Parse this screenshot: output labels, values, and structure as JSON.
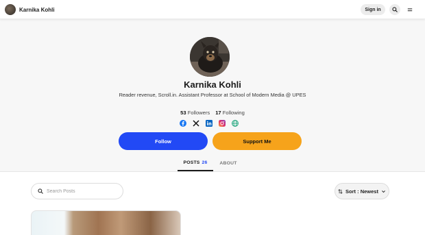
{
  "header": {
    "site_name": "Karnika Kohli",
    "signin_label": "Sign in",
    "search_icon": "search-icon",
    "menu_icon": "menu-icon"
  },
  "profile": {
    "name": "Karnika Kohli",
    "bio": "Reader revenue, Scroll.in. Assistant Professor at School of Modern Media @ UPES",
    "followers_count": "53",
    "followers_label": "Followers",
    "following_count": "17",
    "following_label": "Following",
    "social_links": [
      "facebook-icon",
      "x-icon",
      "linkedin-icon",
      "instagram-icon",
      "globe-icon"
    ]
  },
  "actions": {
    "follow_label": "Follow",
    "support_label": "Support Me"
  },
  "tabs": [
    {
      "label": "POSTS",
      "count": "26",
      "active": true
    },
    {
      "label": "ABOUT",
      "active": false
    }
  ],
  "posts": {
    "search_placeholder": "Search Posts",
    "sort_label": "Sort : Newest"
  },
  "colors": {
    "follow": "#2249f5",
    "support": "#f6a31b",
    "accent_count": "#2249f5"
  }
}
